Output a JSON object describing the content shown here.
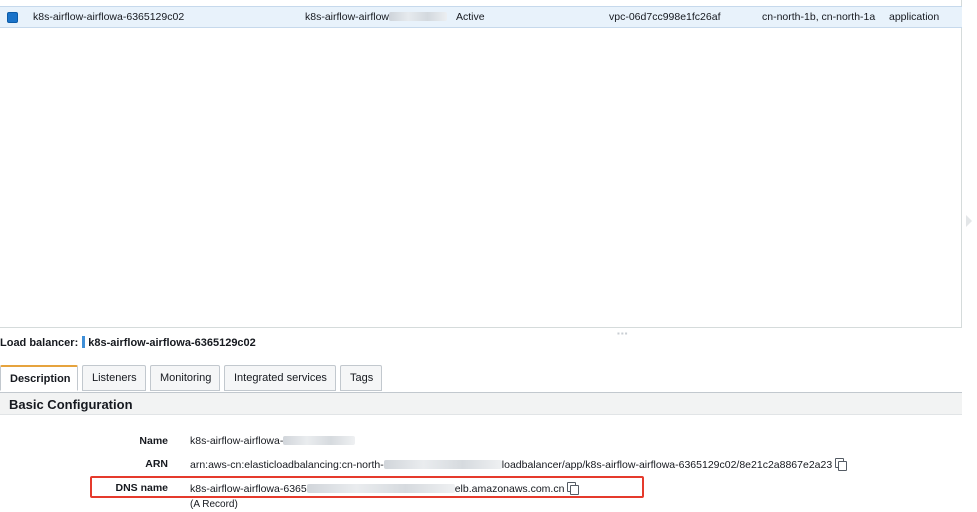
{
  "table": {
    "row": {
      "name": "k8s-airflow-airflowa-6365129c02",
      "dns_visible": "k8s-airflow-airflow",
      "state": "Active",
      "vpc": "vpc-06d7cc998e1fc26af",
      "azs": "cn-north-1b, cn-north-1a",
      "type": "application"
    }
  },
  "detail": {
    "header_label": "Load balancer:",
    "header_value": "k8s-airflow-airflowa-6365129c02",
    "tabs": [
      {
        "label": "Description"
      },
      {
        "label": "Listeners"
      },
      {
        "label": "Monitoring"
      },
      {
        "label": "Integrated services"
      },
      {
        "label": "Tags"
      }
    ],
    "section_title": "Basic Configuration",
    "fields": {
      "name_label": "Name",
      "name_value": "k8s-airflow-airflowa-",
      "arn_label": "ARN",
      "arn_prefix": "arn:aws-cn:elasticloadbalancing:cn-north-",
      "arn_suffix": "loadbalancer/app/k8s-airflow-airflowa-6365129c02/8e21c2a8867e2a23",
      "dns_label": "DNS name",
      "dns_prefix": "k8s-airflow-airflowa-6365",
      "dns_suffix": "elb.amazonaws.com.cn",
      "dns_note": "(A Record)"
    }
  },
  "colors": {
    "selected_row": "#e8f2fb",
    "checkbox": "#1a73c9",
    "active_tab_accent": "#e6a33d",
    "highlight_box": "#e53a2c"
  },
  "icons": [
    "checkbox-checked-icon",
    "copy-icon",
    "expand-arrow-icon"
  ]
}
